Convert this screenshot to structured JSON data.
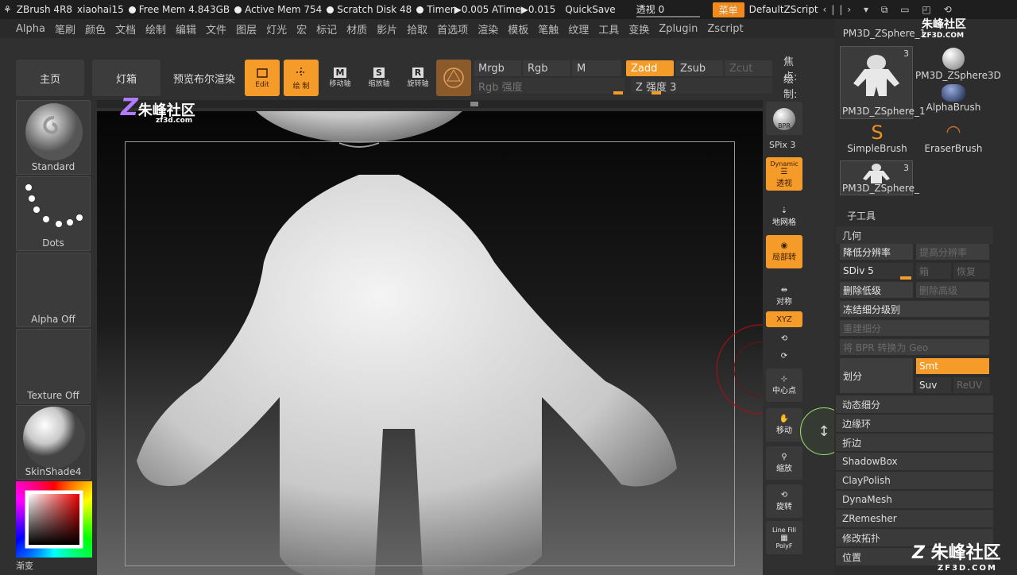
{
  "titlebar": {
    "app": "ZBrush 4R8",
    "user": "xiaohai15",
    "free_mem": "Free Mem 4.843GB",
    "active_mem": "Active Mem 754",
    "scratch": "Scratch Disk 48",
    "timer": "Timer▶0.005 ATime▶0.015",
    "quicksave": "QuickSave",
    "transparency": "透视 0",
    "menu_btn": "菜单",
    "script": "DefaultZScript"
  },
  "menubar": [
    "Alpha",
    "笔刷",
    "颜色",
    "文档",
    "绘制",
    "编辑",
    "文件",
    "图层",
    "灯光",
    "宏",
    "标记",
    "材质",
    "影片",
    "拾取",
    "首选项",
    "渲染",
    "模板",
    "笔触",
    "纹理",
    "工具",
    "变换",
    "Zplugin",
    "Zscript"
  ],
  "toolbar": {
    "home": "主页",
    "lightbox": "灯箱",
    "bpr": "预览布尔渲染",
    "edit": "Edit",
    "draw": "绘 制",
    "move": "移动轴",
    "scale": "缩放轴",
    "rotate": "旋转轴",
    "mrgb": "Mrgb",
    "rgb": "Rgb",
    "m": "M",
    "zadd": "Zadd",
    "zsub": "Zsub",
    "zcut": "Zcut",
    "rgb_intensity": "Rgb 强度",
    "z_intensity": "Z 强度 3",
    "focal": "焦点:",
    "draw_size": "绘制:"
  },
  "left": {
    "brush": "Standard",
    "stroke": "Dots",
    "alpha": "Alpha Off",
    "texture": "Texture Off",
    "material": "SkinShade4",
    "gradient": "渐变"
  },
  "right_icons": {
    "bpr": "BPR",
    "spix": "SPix 3",
    "dynamic": "Dynamic",
    "persp": "透视",
    "floor": "地网格",
    "local": "局部转",
    "sym": "对称",
    "xyz": "XYZ",
    "center": "中心点",
    "move": "移动",
    "zoom": "缩放",
    "rotate": "旋转",
    "linefill": "Line Fill",
    "polyf": "PolyF"
  },
  "tools": {
    "t1": "PM3D_ZSphere_1",
    "t1n": "3",
    "t2": "PM3D_ZSphere3D",
    "t3": "AlphaBrush",
    "t4": "SimpleBrush",
    "t5": "EraserBrush",
    "t6": "PM3D_ZSphere_",
    "t6n": "3",
    "t0": "PM3D_ZSphere_1"
  },
  "subtool": "子工具",
  "geometry": {
    "title": "几何",
    "lower": "降低分辨率",
    "higher": "提高分辨率",
    "sdiv": "SDiv 5",
    "cage": "箱",
    "reconstruct": "恢复",
    "del_lower": "删除低级",
    "del_higher": "删除高级",
    "freeze": "冻结细分级别",
    "rebuild": "重建细分",
    "bpr_geo": "将 BPR 转换为 Geo",
    "divide": "划分",
    "smt": "Smt",
    "suv": "Suv",
    "reuv": "ReUV",
    "dynsub": "动态细分",
    "edgeloop": "边缘环",
    "crease": "折边",
    "shadowbox": "ShadowBox",
    "claypolish": "ClayPolish",
    "dynamesh": "DynaMesh",
    "zremesher": "ZRemesher",
    "topo": "修改拓扑",
    "position": "位置"
  },
  "watermark": {
    "brand": "朱峰社区",
    "site": "zf3d.com",
    "site2": "ZF3D.COM"
  },
  "colors": {
    "accent": "#f59b2a",
    "bg": "#303030"
  }
}
